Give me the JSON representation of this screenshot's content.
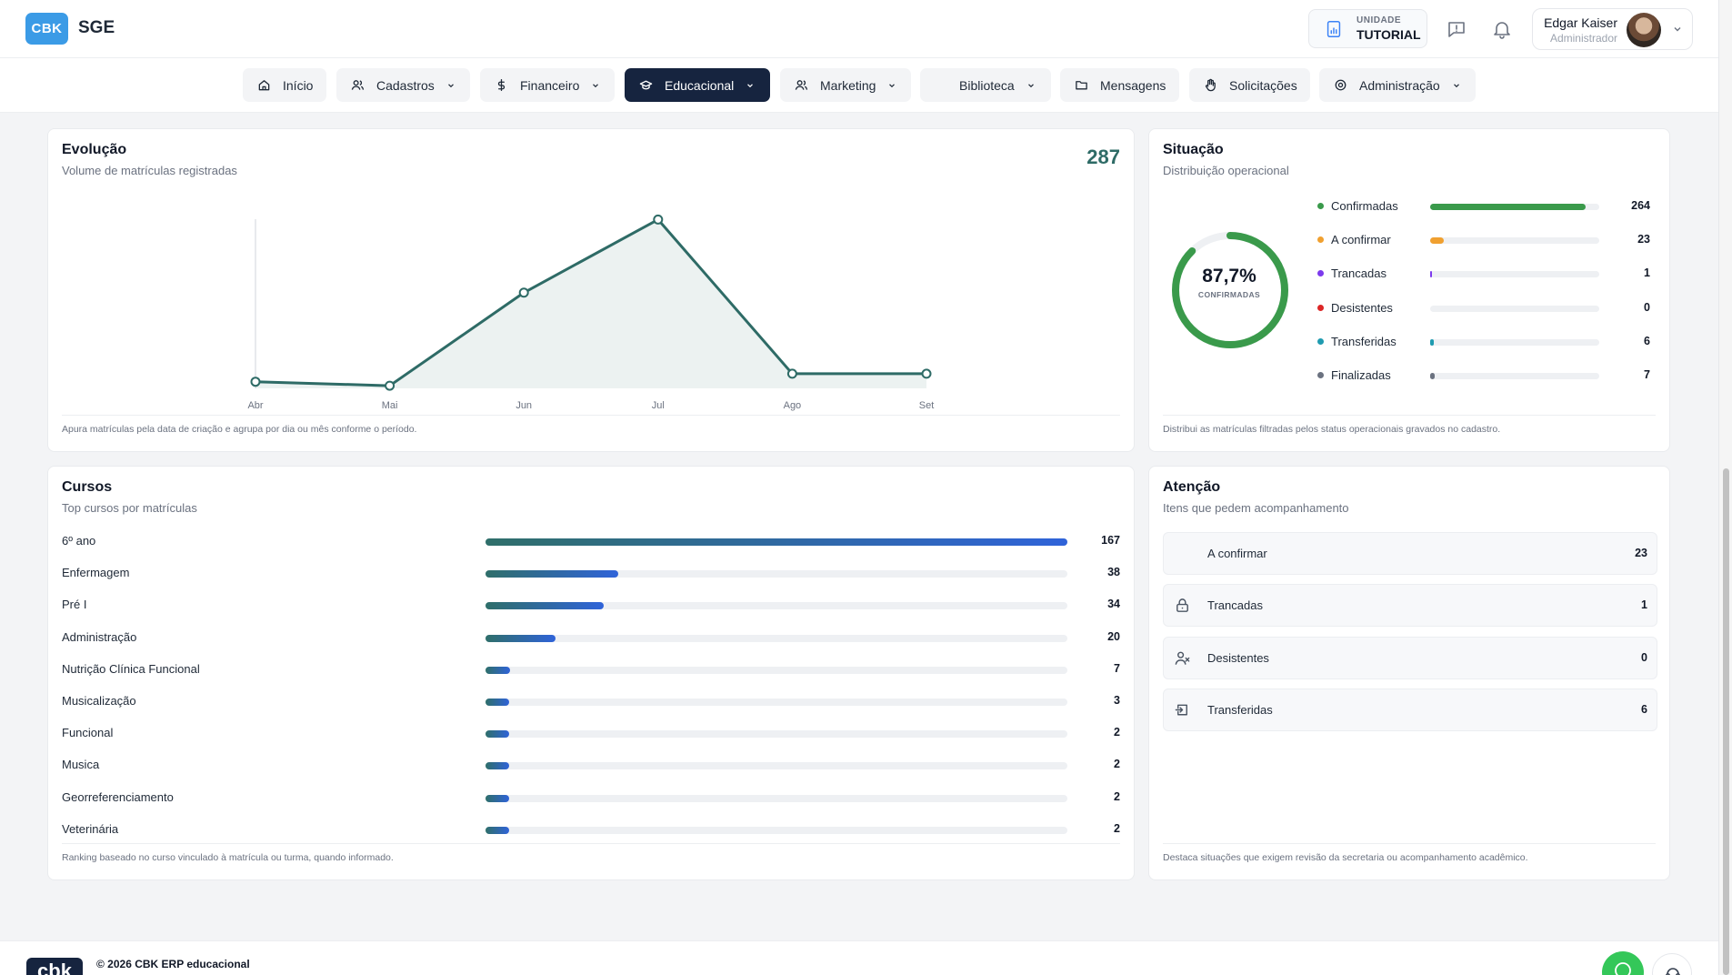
{
  "header": {
    "logo_text": "CBK",
    "app_name": "SGE",
    "unit_label": "UNIDADE",
    "unit_name": "TUTORIAL",
    "user_name": "Edgar Kaiser",
    "user_role": "Administrador"
  },
  "nav": [
    {
      "label": "Início",
      "icon": "home-icon",
      "dropdown": false,
      "active": false
    },
    {
      "label": "Cadastros",
      "icon": "users-icon",
      "dropdown": true,
      "active": false
    },
    {
      "label": "Financeiro",
      "icon": "dollar-icon",
      "dropdown": true,
      "active": false
    },
    {
      "label": "Educacional",
      "icon": "graduation-cap-icon",
      "dropdown": true,
      "active": true
    },
    {
      "label": "Marketing",
      "icon": "users-icon",
      "dropdown": true,
      "active": false
    },
    {
      "label": "Biblioteca",
      "icon": "",
      "dropdown": true,
      "active": false
    },
    {
      "label": "Mensagens",
      "icon": "folder-icon",
      "dropdown": false,
      "active": false
    },
    {
      "label": "Solicitações",
      "icon": "hand-icon",
      "dropdown": false,
      "active": false
    },
    {
      "label": "Administração",
      "icon": "gear-icon",
      "dropdown": true,
      "active": false
    }
  ],
  "evolucao": {
    "title": "Evolução",
    "subtitle": "Volume de matrículas registradas",
    "total": "287",
    "footnote": "Apura matrículas pela data de criação e agrupa por dia ou mês conforme o período."
  },
  "chart_data": {
    "type": "area",
    "categories": [
      "Abr",
      "Mai",
      "Jun",
      "Jul",
      "Ago",
      "Set"
    ],
    "values": [
      5,
      2,
      72,
      127,
      11,
      11
    ],
    "ylim": [
      0,
      130
    ],
    "grid": false,
    "color": "#2e6b66"
  },
  "situacao": {
    "title": "Situação",
    "subtitle": "Distribuição operacional",
    "donut_percent": "87,7%",
    "donut_label": "CONFIRMADAS",
    "donut_fraction": 0.877,
    "max": 287,
    "items": [
      {
        "label": "Confirmadas",
        "count": "264",
        "value": 264,
        "color": "#3a9a4b"
      },
      {
        "label": "A confirmar",
        "count": "23",
        "value": 23,
        "color": "#f0a030"
      },
      {
        "label": "Trancadas",
        "count": "1",
        "value": 1,
        "color": "#7c3aed"
      },
      {
        "label": "Desistentes",
        "count": "0",
        "value": 0,
        "color": "#dc2626"
      },
      {
        "label": "Transferidas",
        "count": "6",
        "value": 6,
        "color": "#1f9bb0"
      },
      {
        "label": "Finalizadas",
        "count": "7",
        "value": 7,
        "color": "#6b7280"
      }
    ],
    "footnote": "Distribui as matrículas filtradas pelos status operacionais gravados no cadastro."
  },
  "cursos": {
    "title": "Cursos",
    "subtitle": "Top cursos por matrículas",
    "max": 167,
    "items": [
      {
        "name": "6º ano",
        "count": "167",
        "value": 167
      },
      {
        "name": "Enfermagem",
        "count": "38",
        "value": 38
      },
      {
        "name": "Pré I",
        "count": "34",
        "value": 34
      },
      {
        "name": "Administração",
        "count": "20",
        "value": 20
      },
      {
        "name": "Nutrição Clínica Funcional",
        "count": "7",
        "value": 7
      },
      {
        "name": "Musicalização",
        "count": "3",
        "value": 3
      },
      {
        "name": "Funcional",
        "count": "2",
        "value": 2
      },
      {
        "name": "Musica",
        "count": "2",
        "value": 2
      },
      {
        "name": "Georreferenciamento",
        "count": "2",
        "value": 2
      },
      {
        "name": "Veterinária",
        "count": "2",
        "value": 2
      }
    ],
    "footnote": "Ranking baseado no curso vinculado à matrícula ou turma, quando informado."
  },
  "atencao": {
    "title": "Atenção",
    "subtitle": "Itens que pedem acompanhamento",
    "items": [
      {
        "label": "A confirmar",
        "count": "23",
        "icon": ""
      },
      {
        "label": "Trancadas",
        "count": "1",
        "icon": "lock-icon"
      },
      {
        "label": "Desistentes",
        "count": "0",
        "icon": "user-remove-icon"
      },
      {
        "label": "Transferidas",
        "count": "6",
        "icon": "transfer-icon"
      }
    ],
    "footnote": "Destaca situações que exigem revisão da secretaria ou acompanhamento acadêmico."
  },
  "footer": {
    "logo_text": "cbk",
    "copyright": "© 2026 CBK ERP educacional"
  }
}
